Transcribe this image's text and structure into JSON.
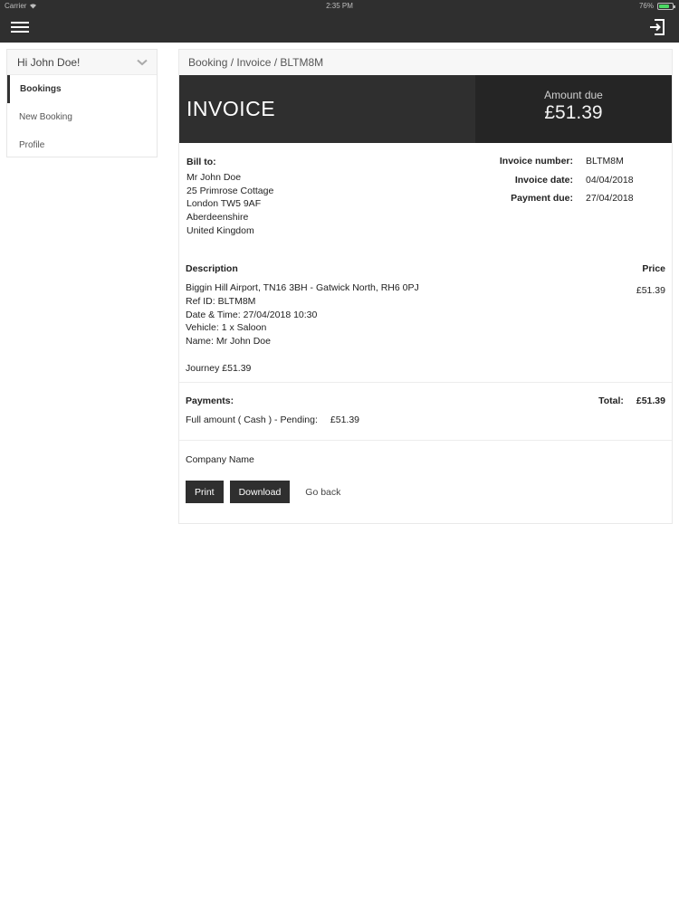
{
  "status_bar": {
    "carrier": "Carrier",
    "time": "2:35 PM",
    "battery": "76%",
    "battery_level": 0.76
  },
  "app_bar": {
    "menu_icon": "menu-icon",
    "logout_icon": "logout-icon"
  },
  "sidebar": {
    "greeting": "Hi John Doe!",
    "items": [
      {
        "label": "Bookings",
        "active": true
      },
      {
        "label": "New Booking"
      },
      {
        "label": "Profile"
      }
    ]
  },
  "breadcrumb": "Booking / Invoice / BLTM8M",
  "invoice": {
    "title": "INVOICE",
    "amount_due_label": "Amount due",
    "amount_due": "£51.39",
    "bill_to": {
      "title": "Bill to:",
      "lines": [
        "Mr John Doe",
        "25 Primrose Cottage",
        "London TW5 9AF",
        "Aberdeenshire",
        "United Kingdom"
      ]
    },
    "meta": [
      {
        "label": "Invoice number:",
        "value": "BLTM8M"
      },
      {
        "label": "Invoice date:",
        "value": "04/04/2018"
      },
      {
        "label": "Payment due:",
        "value": "27/04/2018"
      }
    ],
    "description": {
      "header": "Description",
      "price_header": "Price",
      "lines": [
        "Biggin Hill Airport, TN16 3BH - Gatwick North, RH6 0PJ",
        "Ref ID: BLTM8M",
        "Date & Time: 27/04/2018 10:30",
        "Vehicle: 1 x Saloon",
        "Name: Mr John Doe"
      ],
      "journey": "Journey £51.39",
      "price": "£51.39"
    },
    "payments": {
      "header": "Payments:",
      "line_label": "Full amount ( Cash ) - Pending:",
      "line_amount": "£51.39",
      "total_label": "Total:",
      "total_amount": "£51.39"
    },
    "company": "Company Name",
    "buttons": {
      "print": "Print",
      "download": "Download",
      "go_back": "Go back"
    }
  }
}
